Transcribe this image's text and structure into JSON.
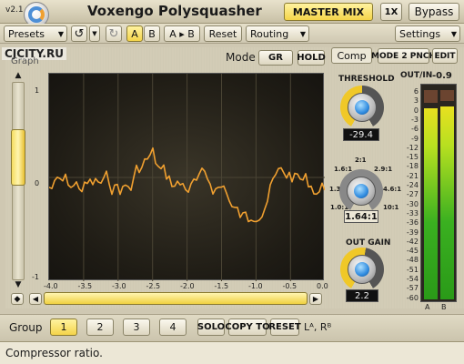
{
  "app": {
    "version": "v2.1",
    "title": "Voxengo Polysquasher",
    "master_mix": "MASTER MIX",
    "ratio_btn": "1X",
    "bypass": "Bypass"
  },
  "watermark": "CJCITY.RU",
  "toolbar": {
    "presets": "Presets",
    "a": "A",
    "b": "B",
    "atob": "A ▸ B",
    "reset": "Reset",
    "routing": "Routing",
    "settings": "Settings"
  },
  "graph": {
    "mode_label": "Mode",
    "mode_gr": "GR",
    "mode_hold": "HOLD",
    "graph_label": "Graph",
    "y_ticks": [
      "1",
      "0",
      "-1"
    ],
    "x_ticks": [
      "-4.0",
      "-3.5",
      "-3.0",
      "-2.5",
      "-2.0",
      "-1.5",
      "-1.0",
      "-0.5",
      "0.0"
    ],
    "line_color": "#f0a030"
  },
  "right": {
    "tab_comp": "Comp",
    "mode2": "MODE 2 PNCH",
    "edit": "EDIT",
    "outin_label": "OUT/IN",
    "outin_value": "-0.9",
    "threshold_label": "THRESHOLD",
    "threshold_value": "-29.4",
    "ratio_marks": [
      "2:1",
      "1.6:1",
      "2.9:1",
      "1.3:1",
      "4.6:1",
      "1.0:1",
      "10:1"
    ],
    "ratio_value": "1.64:1",
    "outgain_label": "OUT GAIN",
    "outgain_value": "2.2",
    "meter_scale": [
      "6",
      "3",
      "0",
      "-3",
      "-6",
      "-9",
      "-12",
      "-15",
      "-18",
      "-21",
      "-24",
      "-27",
      "-30",
      "-33",
      "-36",
      "-39",
      "-42",
      "-45",
      "-48",
      "-51",
      "-54",
      "-57",
      "-60"
    ],
    "meter_a": "A",
    "meter_b": "B"
  },
  "group": {
    "label": "Group",
    "g1": "1",
    "g2": "2",
    "g3": "3",
    "g4": "4",
    "solo": "SOLO",
    "copyto": "COPY TO",
    "reset": "RESET",
    "lr": "Lᴬ, Rᴮ"
  },
  "status": {
    "text": "Compressor ratio."
  },
  "colors": {
    "accent": "#f4d44a",
    "knob": "#2f8be0"
  }
}
